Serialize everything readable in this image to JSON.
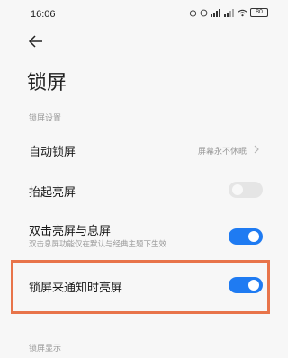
{
  "status_bar": {
    "time": "16:06",
    "battery": "80"
  },
  "page": {
    "title": "锁屏"
  },
  "sections": {
    "lock_settings": "锁屏设置",
    "lock_display": "锁屏显示"
  },
  "rows": {
    "auto_lock": {
      "title": "自动锁屏",
      "value": "屏幕永不休眠"
    },
    "raise_to_wake": {
      "title": "抬起亮屏",
      "enabled": false
    },
    "double_tap": {
      "title": "双击亮屏与息屏",
      "subtitle": "双击息屏功能仅在默认与经典主题下生效",
      "enabled": true
    },
    "notify_wake": {
      "title": "锁屏来通知时亮屏",
      "enabled": true
    }
  },
  "colors": {
    "toggle_on": "#1f7bf2",
    "toggle_off": "#e5e5e5",
    "highlight": "#e8744a"
  }
}
